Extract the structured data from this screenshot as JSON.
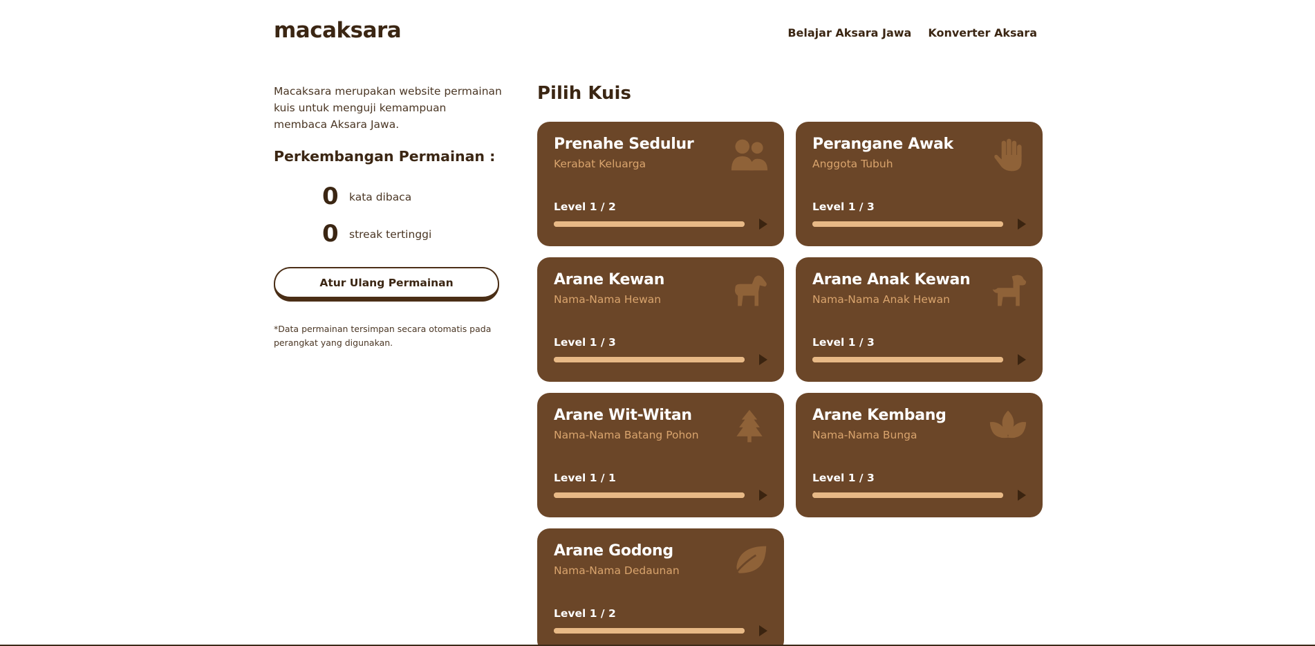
{
  "header": {
    "logo": "macaksara",
    "nav": [
      "Belajar Aksara Jawa",
      "Konverter Aksara"
    ]
  },
  "sidebar": {
    "intro": "Macaksara merupakan website permainan kuis untuk menguji kemampuan membaca Aksara Jawa.",
    "progress_title": "Perkembangan Permainan :",
    "stats": [
      {
        "value": "0",
        "label": "kata dibaca"
      },
      {
        "value": "0",
        "label": "streak tertinggi"
      }
    ],
    "reset_label": "Atur Ulang Permainan",
    "note": "*Data permainan tersimpan secara otomatis pada perangkat yang digunakan."
  },
  "main": {
    "title": "Pilih Kuis",
    "quizzes": [
      {
        "title": "Prenahe Sedulur",
        "subtitle": "Kerabat Keluarga",
        "level": "Level 1 / 2",
        "icon": "users-icon",
        "progress": 1.0
      },
      {
        "title": "Perangane Awak",
        "subtitle": "Anggota Tubuh",
        "level": "Level 1 / 3",
        "icon": "hand-icon",
        "progress": 1.0
      },
      {
        "title": "Arane Kewan",
        "subtitle": "Nama-Nama Hewan",
        "level": "Level 1 / 3",
        "icon": "horse-icon",
        "progress": 1.0
      },
      {
        "title": "Arane Anak Kewan",
        "subtitle": "Nama-Nama Anak Hewan",
        "level": "Level 1 / 3",
        "icon": "dog-icon",
        "progress": 1.0
      },
      {
        "title": "Arane Wit-Witan",
        "subtitle": "Nama-Nama Batang Pohon",
        "level": "Level 1 / 1",
        "icon": "tree-icon",
        "progress": 1.0
      },
      {
        "title": "Arane Kembang",
        "subtitle": "Nama-Nama Bunga",
        "level": "Level 1 / 3",
        "icon": "lotus-icon",
        "progress": 1.0
      },
      {
        "title": "Arane Godong",
        "subtitle": "Nama-Nama Dedaunan",
        "level": "Level 1 / 2",
        "icon": "leaf-icon",
        "progress": 1.0
      }
    ]
  },
  "colors": {
    "card_bg": "#6b4628",
    "accent": "#d9a46d",
    "bar": "#e2b07a",
    "text_dark": "#3b2613",
    "icon": "#8f6238"
  }
}
